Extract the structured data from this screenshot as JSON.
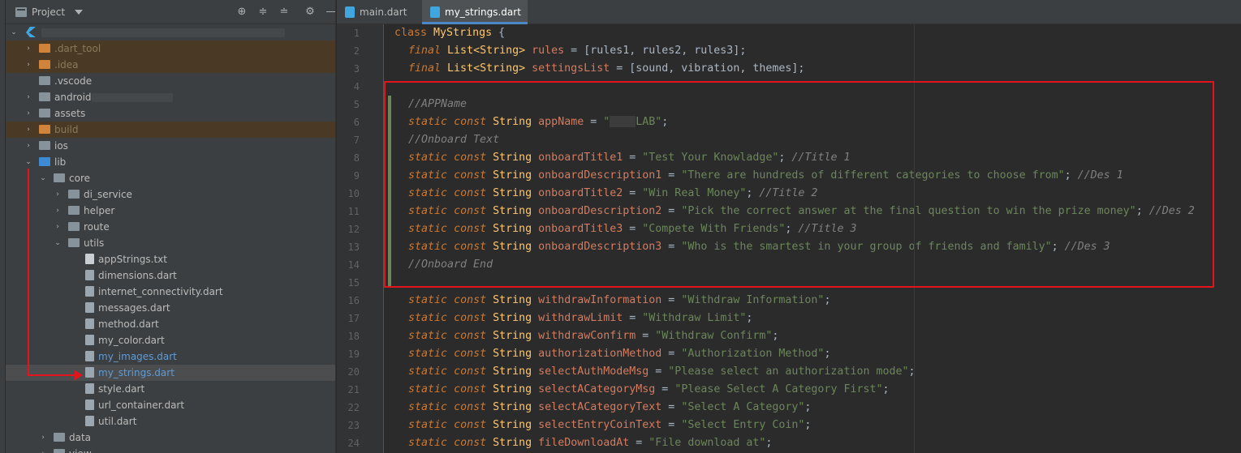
{
  "project_panel": {
    "title": "Project",
    "tree": [
      {
        "label": "",
        "kind": "root"
      },
      {
        "label": ".dart_tool",
        "kind": "folder-orange"
      },
      {
        "label": ".idea",
        "kind": "folder-orange"
      },
      {
        "label": ".vscode",
        "kind": "folder"
      },
      {
        "label": "android",
        "kind": "folder"
      },
      {
        "label": "assets",
        "kind": "folder"
      },
      {
        "label": "build",
        "kind": "folder-orange"
      },
      {
        "label": "ios",
        "kind": "folder"
      },
      {
        "label": "lib",
        "kind": "folder-blue"
      },
      {
        "label": "core",
        "kind": "folder"
      },
      {
        "label": "di_service",
        "kind": "folder"
      },
      {
        "label": "helper",
        "kind": "folder"
      },
      {
        "label": "route",
        "kind": "folder"
      },
      {
        "label": "utils",
        "kind": "folder"
      },
      {
        "label": "appStrings.txt",
        "kind": "file"
      },
      {
        "label": "dimensions.dart",
        "kind": "file"
      },
      {
        "label": "internet_connectivity.dart",
        "kind": "file"
      },
      {
        "label": "messages.dart",
        "kind": "file"
      },
      {
        "label": "method.dart",
        "kind": "file"
      },
      {
        "label": "my_color.dart",
        "kind": "file"
      },
      {
        "label": "my_images.dart",
        "kind": "file"
      },
      {
        "label": "my_strings.dart",
        "kind": "file"
      },
      {
        "label": "style.dart",
        "kind": "file"
      },
      {
        "label": "url_container.dart",
        "kind": "file"
      },
      {
        "label": "util.dart",
        "kind": "file"
      },
      {
        "label": "data",
        "kind": "folder"
      },
      {
        "label": "view",
        "kind": "folder"
      }
    ]
  },
  "tabs": [
    {
      "label": "main.dart",
      "close": "×"
    },
    {
      "label": "my_strings.dart",
      "close": "×"
    }
  ],
  "line_numbers": [
    "1",
    "2",
    "3",
    "4",
    "5",
    "6",
    "7",
    "8",
    "9",
    "10",
    "11",
    "12",
    "13",
    "14",
    "15",
    "16",
    "17",
    "18",
    "19",
    "20",
    "21",
    "22",
    "23",
    "24"
  ],
  "code": {
    "l1": {
      "kw": "class",
      "name": "MyStrings",
      "brace": " {"
    },
    "l2": {
      "kw": "final",
      "type": "List<String>",
      "name": "rules",
      "rest": " = [rules1, rules2, rules3];"
    },
    "l3": {
      "kw": "final",
      "type": "List<String>",
      "name": "settingsList",
      "rest": " = [sound, vibration, themes];"
    },
    "l5": {
      "comment": "//APPName"
    },
    "l6": {
      "name": "appName",
      "val_pre": "\"",
      "val_post": "LAB\"",
      "end": ";"
    },
    "l7": {
      "comment": "//Onboard Text"
    },
    "l8": {
      "name": "onboardTitle1",
      "val": "\"Test Your Knowladge\"",
      "comment": "//Title 1"
    },
    "l9": {
      "name": "onboardDescription1",
      "val": "\"There are hundreds of different categories to choose from\"",
      "comment": "//Des 1"
    },
    "l10": {
      "name": "onboardTitle2",
      "val": "\"Win Real Money\"",
      "comment": "//Title 2"
    },
    "l11": {
      "name": "onboardDescription2",
      "val": "\"Pick the correct answer at the final question to win the prize money\"",
      "comment": "//Des 2"
    },
    "l12": {
      "name": "onboardTitle3",
      "val": "\"Compete With Friends\"",
      "comment": "//Title 3"
    },
    "l13": {
      "name": "onboardDescription3",
      "val": "\"Who is the smartest in your group of friends and family\"",
      "comment": "//Des 3"
    },
    "l14": {
      "comment": "//Onboard End"
    },
    "l16": {
      "name": "withdrawInformation",
      "val": "\"Withdraw Information\""
    },
    "l17": {
      "name": "withdrawLimit",
      "val": "\"Withdraw Limit\""
    },
    "l18": {
      "name": "withdrawConfirm",
      "val": "\"Withdraw Confirm\""
    },
    "l19": {
      "name": "authorizationMethod",
      "val": "\"Authorization Method\""
    },
    "l20": {
      "name": "selectAuthModeMsg",
      "val": "\"Please select an authorization mode\""
    },
    "l21": {
      "name": "selectACategoryMsg",
      "val": "\"Please Select A Category First\""
    },
    "l22": {
      "name": "selectACategoryText",
      "val": "\"Select A Category\""
    },
    "l23": {
      "name": "selectEntryCoinText",
      "val": "\"Select Entry Coin\""
    },
    "l24": {
      "name": "fileDownloadAt",
      "val": "\"File download at\""
    },
    "static": "static",
    "const": "const",
    "string": "String",
    "eq": " = ",
    "semi": ";",
    "semi_sp": "; "
  }
}
